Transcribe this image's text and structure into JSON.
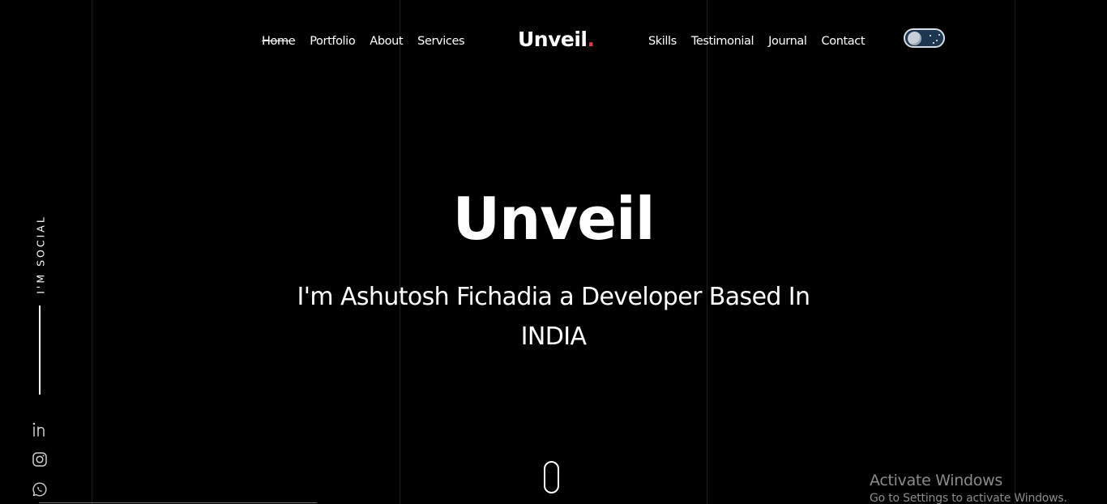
{
  "nav": {
    "left_items": [
      {
        "label": "Home",
        "active": true
      },
      {
        "label": "Portfolio",
        "active": false
      },
      {
        "label": "About",
        "active": false
      },
      {
        "label": "Services",
        "active": false
      }
    ],
    "right_items": [
      {
        "label": "Skills",
        "active": false
      },
      {
        "label": "Testimonial",
        "active": false
      },
      {
        "label": "Journal",
        "active": false
      },
      {
        "label": "Contact",
        "active": false
      }
    ],
    "logo": {
      "text": "Unveil",
      "dot": "."
    },
    "theme_toggle": {
      "state": "dark",
      "icon": "moon-icon"
    }
  },
  "hero": {
    "title": "Unveil",
    "subtitle": "I'm Ashutosh Fichadia a Developer Based In INDIA"
  },
  "social": {
    "label": "I'M SOCIAL",
    "icons": [
      "linkedin-icon",
      "instagram-icon",
      "whatsapp-icon"
    ]
  },
  "scroll_indicator": {
    "icon": "mouse-scroll-icon"
  },
  "watermark": {
    "title": "Activate Windows",
    "subtitle": "Go to Settings to activate Windows."
  },
  "colors": {
    "background": "#000000",
    "text": "#ffffff",
    "accent": "#e03a4e",
    "grid_line": "#1c1c1c",
    "toggle_bg": "#1f3650"
  }
}
